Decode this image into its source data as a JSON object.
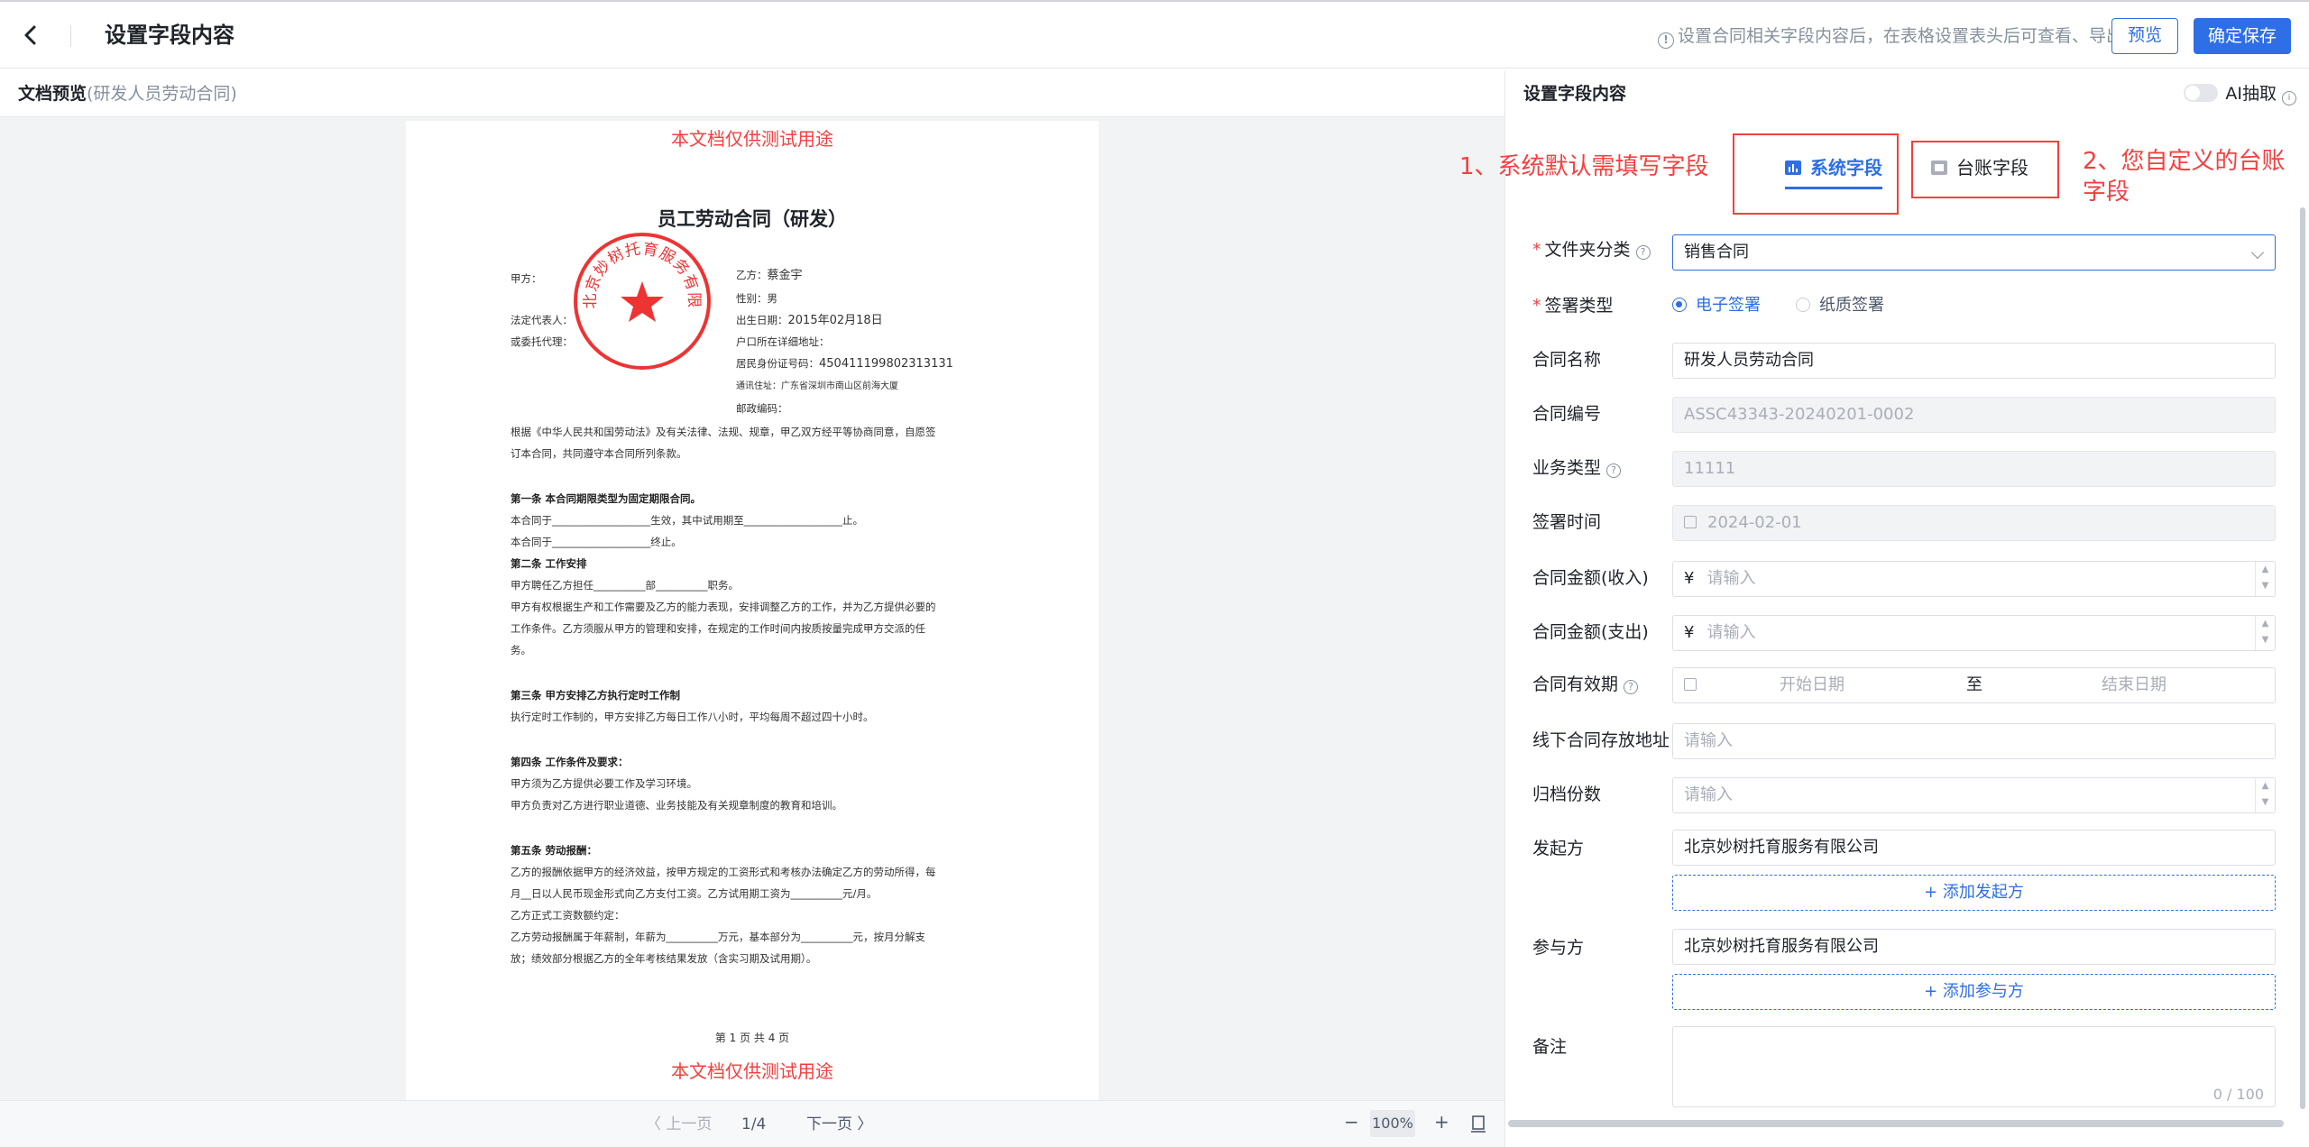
{
  "header": {
    "title": "设置字段内容",
    "tip": "设置合同相关字段内容后，在表格设置表头后可查看、导出",
    "preview_btn": "预览",
    "save_btn": "确定保存"
  },
  "preview": {
    "label": "文档预览",
    "doc_name": "(研发人员劳动合同)",
    "watermark": "本文档仅供测试用途",
    "doc_title": "员工劳动合同（研发）",
    "seal_text": "北京妙树托育服务有限公司",
    "lines": {
      "jiafang": "甲方：",
      "yifang": "乙方：",
      "yifang_name": "蔡金宇",
      "gender": "性别：",
      "gender_val": "男",
      "rep": "法定代表人：",
      "birth": "出生日期：",
      "birth_val": "2015年02月18日",
      "agent": "或委托代理：",
      "hukou": "户口所在详细地址：",
      "idno": "居民身份证号码：",
      "idno_val": "450411199802313131",
      "addr": "通讯住址：广东省深圳市南山区前海大厦",
      "post": "邮政编码：",
      "p1": "根据《中华人民共和国劳动法》及有关法律、法规、规章，甲乙双方经平等协商同意，自愿签",
      "p2": "订本合同，共同遵守本合同所列条款。",
      "a1": "第一条   本合同期限类型为固定期限合同。",
      "a1l1": "本合同于___________________生效，其中试用期至___________________止。",
      "a1l2": "本合同于___________________终止。",
      "a2": "第二条  工作安排",
      "a2l1": "甲方聘任乙方担任__________部__________职务。",
      "a2l2": "甲方有权根据生产和工作需要及乙方的能力表现，安排调整乙方的工作，并为乙方提供必要的",
      "a2l3": "工作条件。乙方须服从甲方的管理和安排，在规定的工作时间内按质按量完成甲方交派的任",
      "a2l4": "务。",
      "a3": "第三条  甲方安排乙方执行定时工作制",
      "a3l1": "执行定时工作制的，甲方安排乙方每日工作八小时，平均每周不超过四十小时。",
      "a4": "第四条  工作条件及要求：",
      "a4l1": "甲方须为乙方提供必要工作及学习环境。",
      "a4l2": "甲方负责对乙方进行职业道德、业务技能及有关规章制度的教育和培训。",
      "a5": "第五条   劳动报酬：",
      "a5l1": "乙方的报酬依据甲方的经济效益，按甲方规定的工资形式和考核办法确定乙方的劳动所得，每",
      "a5l2": "月__日以人民币现金形式向乙方支付工资。乙方试用期工资为__________元/月。",
      "a5l3": "乙方正式工资数额约定：",
      "a5l4": "乙方劳动报酬属于年薪制，年薪为__________万元，基本部分为__________元，按月分解支",
      "a5l5": "放；绩效部分根据乙方的全年考核结果发放（含实习期及试用期）。",
      "footer": "第 1 页 共 4 页"
    }
  },
  "pager": {
    "prev": "〈 上一页",
    "page": "1/4",
    "next": "下一页 〉",
    "zoom_out": "−",
    "zoom": "100%",
    "zoom_in": "+"
  },
  "panel": {
    "title": "设置字段内容",
    "ai_label": "AI抽取",
    "ai_enabled": false,
    "note1": "1、系统默认需填写字段",
    "note2_line1": "2、您自定义的台账",
    "note2_line2": "字段",
    "tab_system": "系统字段",
    "tab_ledger": "台账字段",
    "fields": {
      "folder_label": "文件夹分类",
      "folder_value": "销售合同",
      "signtype_label": "签署类型",
      "sign_electronic": "电子签署",
      "sign_paper": "纸质签署",
      "name_label": "合同名称",
      "name_value": "研发人员劳动合同",
      "code_label": "合同编号",
      "code_value": "ASSC43343-20240201-0002",
      "biz_label": "业务类型",
      "biz_value": "11111",
      "signtime_label": "签署时间",
      "signtime_value": "2024-02-01",
      "income_label": "合同金额(收入)",
      "expense_label": "合同金额(支出)",
      "currency": "¥",
      "input_placeholder": "请输入",
      "valid_label": "合同有效期",
      "start_placeholder": "开始日期",
      "to": "至",
      "end_placeholder": "结束日期",
      "offline_label": "线下合同存放地址",
      "copies_label": "归档份数",
      "initiator_label": "发起方",
      "initiator_value": "北京妙树托育服务有限公司",
      "add_initiator": "+ 添加发起方",
      "participant_label": "参与方",
      "participant_value": "北京妙树托育服务有限公司",
      "add_participant": "+ 添加参与方",
      "remark_label": "备注",
      "remark_count": "0 / 100"
    }
  },
  "colors": {
    "primary": "#2e6ee6",
    "annotation_red": "#f53f3f"
  }
}
